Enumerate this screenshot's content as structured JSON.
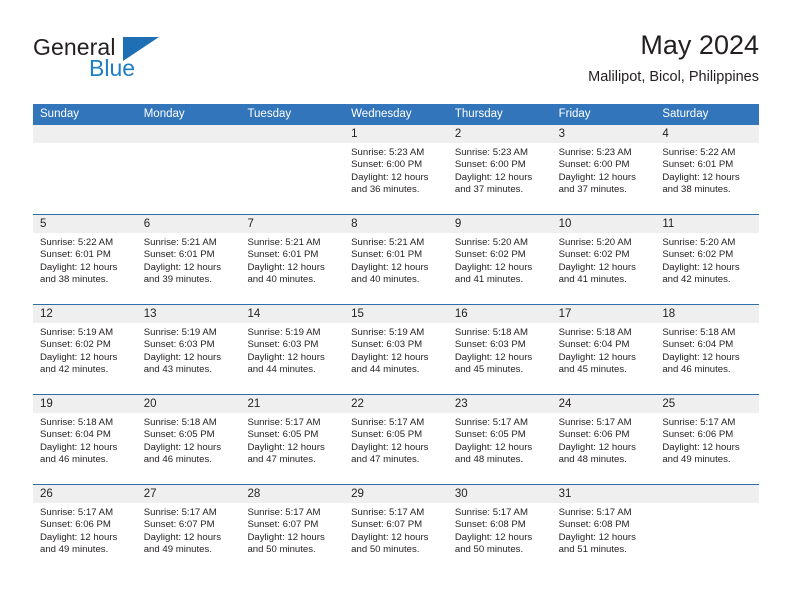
{
  "brand": {
    "name_top": "General",
    "name_bottom": "Blue",
    "accent_color": "#1f7fc4",
    "triangle_color": "#1f6fb4"
  },
  "header": {
    "title": "May 2024",
    "subtitle": "Malilipot, Bicol, Philippines"
  },
  "theme": {
    "header_bg": "#3275bb",
    "header_text": "#ffffff",
    "date_band_bg": "#efefef",
    "week_rule": "#2e6da8",
    "text": "#231f20"
  },
  "weekdays": [
    "Sunday",
    "Monday",
    "Tuesday",
    "Wednesday",
    "Thursday",
    "Friday",
    "Saturday"
  ],
  "weeks": [
    [
      {
        "day": "",
        "sunrise": "",
        "sunset": "",
        "daylight_line1": "",
        "daylight_line2": ""
      },
      {
        "day": "",
        "sunrise": "",
        "sunset": "",
        "daylight_line1": "",
        "daylight_line2": ""
      },
      {
        "day": "",
        "sunrise": "",
        "sunset": "",
        "daylight_line1": "",
        "daylight_line2": ""
      },
      {
        "day": "1",
        "sunrise": "Sunrise: 5:23 AM",
        "sunset": "Sunset: 6:00 PM",
        "daylight_line1": "Daylight: 12 hours",
        "daylight_line2": "and 36 minutes."
      },
      {
        "day": "2",
        "sunrise": "Sunrise: 5:23 AM",
        "sunset": "Sunset: 6:00 PM",
        "daylight_line1": "Daylight: 12 hours",
        "daylight_line2": "and 37 minutes."
      },
      {
        "day": "3",
        "sunrise": "Sunrise: 5:23 AM",
        "sunset": "Sunset: 6:00 PM",
        "daylight_line1": "Daylight: 12 hours",
        "daylight_line2": "and 37 minutes."
      },
      {
        "day": "4",
        "sunrise": "Sunrise: 5:22 AM",
        "sunset": "Sunset: 6:01 PM",
        "daylight_line1": "Daylight: 12 hours",
        "daylight_line2": "and 38 minutes."
      }
    ],
    [
      {
        "day": "5",
        "sunrise": "Sunrise: 5:22 AM",
        "sunset": "Sunset: 6:01 PM",
        "daylight_line1": "Daylight: 12 hours",
        "daylight_line2": "and 38 minutes."
      },
      {
        "day": "6",
        "sunrise": "Sunrise: 5:21 AM",
        "sunset": "Sunset: 6:01 PM",
        "daylight_line1": "Daylight: 12 hours",
        "daylight_line2": "and 39 minutes."
      },
      {
        "day": "7",
        "sunrise": "Sunrise: 5:21 AM",
        "sunset": "Sunset: 6:01 PM",
        "daylight_line1": "Daylight: 12 hours",
        "daylight_line2": "and 40 minutes."
      },
      {
        "day": "8",
        "sunrise": "Sunrise: 5:21 AM",
        "sunset": "Sunset: 6:01 PM",
        "daylight_line1": "Daylight: 12 hours",
        "daylight_line2": "and 40 minutes."
      },
      {
        "day": "9",
        "sunrise": "Sunrise: 5:20 AM",
        "sunset": "Sunset: 6:02 PM",
        "daylight_line1": "Daylight: 12 hours",
        "daylight_line2": "and 41 minutes."
      },
      {
        "day": "10",
        "sunrise": "Sunrise: 5:20 AM",
        "sunset": "Sunset: 6:02 PM",
        "daylight_line1": "Daylight: 12 hours",
        "daylight_line2": "and 41 minutes."
      },
      {
        "day": "11",
        "sunrise": "Sunrise: 5:20 AM",
        "sunset": "Sunset: 6:02 PM",
        "daylight_line1": "Daylight: 12 hours",
        "daylight_line2": "and 42 minutes."
      }
    ],
    [
      {
        "day": "12",
        "sunrise": "Sunrise: 5:19 AM",
        "sunset": "Sunset: 6:02 PM",
        "daylight_line1": "Daylight: 12 hours",
        "daylight_line2": "and 42 minutes."
      },
      {
        "day": "13",
        "sunrise": "Sunrise: 5:19 AM",
        "sunset": "Sunset: 6:03 PM",
        "daylight_line1": "Daylight: 12 hours",
        "daylight_line2": "and 43 minutes."
      },
      {
        "day": "14",
        "sunrise": "Sunrise: 5:19 AM",
        "sunset": "Sunset: 6:03 PM",
        "daylight_line1": "Daylight: 12 hours",
        "daylight_line2": "and 44 minutes."
      },
      {
        "day": "15",
        "sunrise": "Sunrise: 5:19 AM",
        "sunset": "Sunset: 6:03 PM",
        "daylight_line1": "Daylight: 12 hours",
        "daylight_line2": "and 44 minutes."
      },
      {
        "day": "16",
        "sunrise": "Sunrise: 5:18 AM",
        "sunset": "Sunset: 6:03 PM",
        "daylight_line1": "Daylight: 12 hours",
        "daylight_line2": "and 45 minutes."
      },
      {
        "day": "17",
        "sunrise": "Sunrise: 5:18 AM",
        "sunset": "Sunset: 6:04 PM",
        "daylight_line1": "Daylight: 12 hours",
        "daylight_line2": "and 45 minutes."
      },
      {
        "day": "18",
        "sunrise": "Sunrise: 5:18 AM",
        "sunset": "Sunset: 6:04 PM",
        "daylight_line1": "Daylight: 12 hours",
        "daylight_line2": "and 46 minutes."
      }
    ],
    [
      {
        "day": "19",
        "sunrise": "Sunrise: 5:18 AM",
        "sunset": "Sunset: 6:04 PM",
        "daylight_line1": "Daylight: 12 hours",
        "daylight_line2": "and 46 minutes."
      },
      {
        "day": "20",
        "sunrise": "Sunrise: 5:18 AM",
        "sunset": "Sunset: 6:05 PM",
        "daylight_line1": "Daylight: 12 hours",
        "daylight_line2": "and 46 minutes."
      },
      {
        "day": "21",
        "sunrise": "Sunrise: 5:17 AM",
        "sunset": "Sunset: 6:05 PM",
        "daylight_line1": "Daylight: 12 hours",
        "daylight_line2": "and 47 minutes."
      },
      {
        "day": "22",
        "sunrise": "Sunrise: 5:17 AM",
        "sunset": "Sunset: 6:05 PM",
        "daylight_line1": "Daylight: 12 hours",
        "daylight_line2": "and 47 minutes."
      },
      {
        "day": "23",
        "sunrise": "Sunrise: 5:17 AM",
        "sunset": "Sunset: 6:05 PM",
        "daylight_line1": "Daylight: 12 hours",
        "daylight_line2": "and 48 minutes."
      },
      {
        "day": "24",
        "sunrise": "Sunrise: 5:17 AM",
        "sunset": "Sunset: 6:06 PM",
        "daylight_line1": "Daylight: 12 hours",
        "daylight_line2": "and 48 minutes."
      },
      {
        "day": "25",
        "sunrise": "Sunrise: 5:17 AM",
        "sunset": "Sunset: 6:06 PM",
        "daylight_line1": "Daylight: 12 hours",
        "daylight_line2": "and 49 minutes."
      }
    ],
    [
      {
        "day": "26",
        "sunrise": "Sunrise: 5:17 AM",
        "sunset": "Sunset: 6:06 PM",
        "daylight_line1": "Daylight: 12 hours",
        "daylight_line2": "and 49 minutes."
      },
      {
        "day": "27",
        "sunrise": "Sunrise: 5:17 AM",
        "sunset": "Sunset: 6:07 PM",
        "daylight_line1": "Daylight: 12 hours",
        "daylight_line2": "and 49 minutes."
      },
      {
        "day": "28",
        "sunrise": "Sunrise: 5:17 AM",
        "sunset": "Sunset: 6:07 PM",
        "daylight_line1": "Daylight: 12 hours",
        "daylight_line2": "and 50 minutes."
      },
      {
        "day": "29",
        "sunrise": "Sunrise: 5:17 AM",
        "sunset": "Sunset: 6:07 PM",
        "daylight_line1": "Daylight: 12 hours",
        "daylight_line2": "and 50 minutes."
      },
      {
        "day": "30",
        "sunrise": "Sunrise: 5:17 AM",
        "sunset": "Sunset: 6:08 PM",
        "daylight_line1": "Daylight: 12 hours",
        "daylight_line2": "and 50 minutes."
      },
      {
        "day": "31",
        "sunrise": "Sunrise: 5:17 AM",
        "sunset": "Sunset: 6:08 PM",
        "daylight_line1": "Daylight: 12 hours",
        "daylight_line2": "and 51 minutes."
      },
      {
        "day": "",
        "sunrise": "",
        "sunset": "",
        "daylight_line1": "",
        "daylight_line2": ""
      }
    ]
  ]
}
